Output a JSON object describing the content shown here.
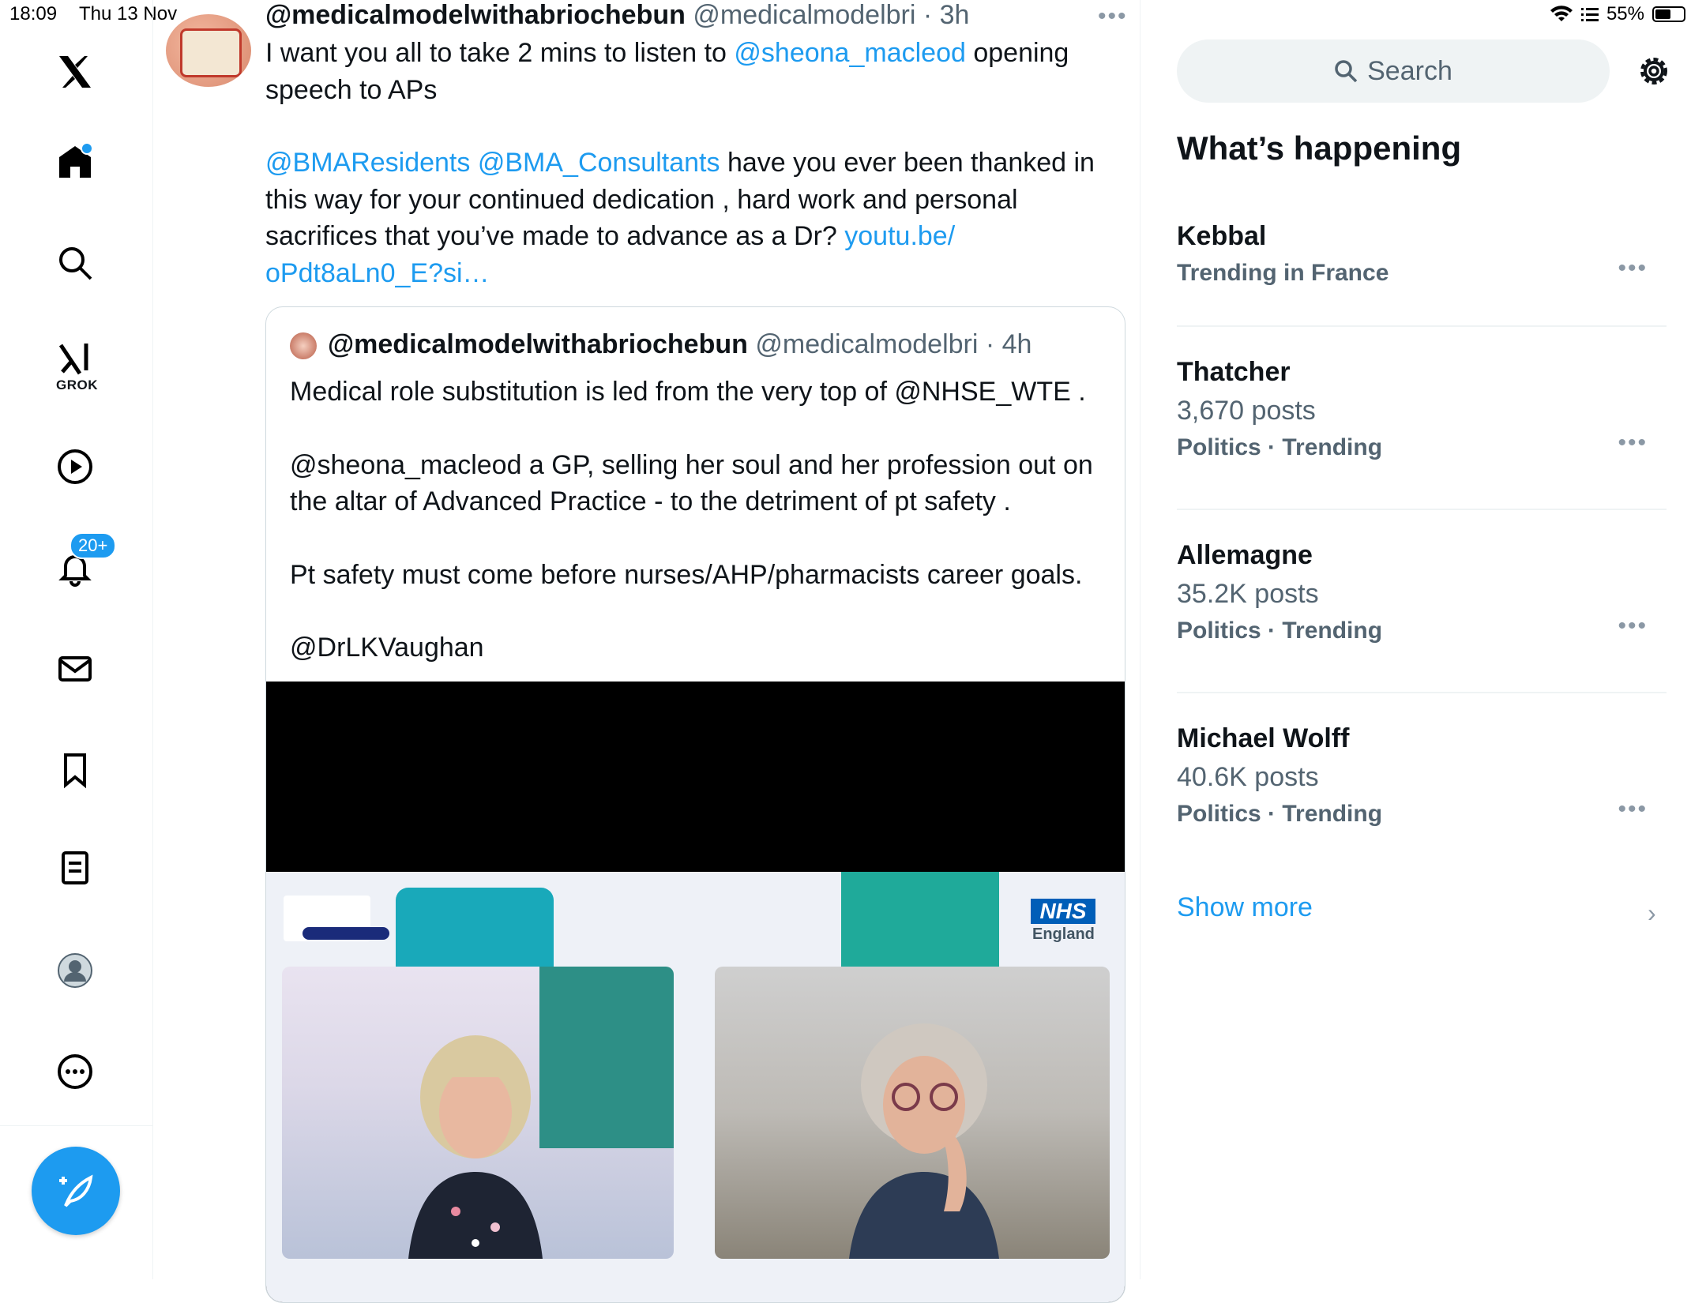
{
  "status_bar": {
    "time": "18:09",
    "date": "Thu 13 Nov",
    "battery": "55%",
    "battery_level": 0.55
  },
  "nav": {
    "notifications_badge": "20+",
    "grok_label": "GROK",
    "items": [
      "x-logo",
      "home",
      "search",
      "grok",
      "videos",
      "notifications",
      "messages",
      "bookmarks",
      "lists",
      "profile",
      "more"
    ]
  },
  "tweet": {
    "display_name": "@medicalmodelwithabriochebun",
    "handle": "@medicalmodelbri",
    "time": "3h",
    "line1_pre": "I want you all to take 2 mins to listen to ",
    "mention1": "@sheona_macleod",
    "line1_post": " opening speech to APs",
    "mention2": "@BMAResidents",
    "mention3": "@BMA_Consultants",
    "para2": " have you ever been thanked in this way for your continued dedication , hard work and personal sacrifices that you’ve made to advance as a Dr? ",
    "link": "youtu.be/ oPdt8aLn0_E?si…"
  },
  "quote": {
    "display_name": "@medicalmodelwithabriochebun",
    "handle": "@medicalmodelbri",
    "time": "4h",
    "para1": "Medical role substitution is led from the very top of @NHSE_WTE .",
    "para2": "@sheona_macleod a GP, selling her soul and her profession out on the altar of Advanced Practice - to the detriment of pt safety .",
    "para3": "Pt safety must come before nurses/AHP/pharmacists career goals.",
    "para4": "@DrLKVaughan",
    "media": {
      "nhs_logo": "NHS",
      "nhs_sub": "England"
    }
  },
  "sidebar": {
    "search_placeholder": "Search",
    "title": "What’s happening",
    "trends": [
      {
        "name": "Kebbal",
        "count": "",
        "category": "Trending in France"
      },
      {
        "name": "Thatcher",
        "count": "3,670 posts",
        "category": "Politics · Trending"
      },
      {
        "name": "Allemagne",
        "count": "35.2K posts",
        "category": "Politics · Trending"
      },
      {
        "name": "Michael Wolff",
        "count": "40.6K posts",
        "category": "Politics · Trending"
      }
    ],
    "show_more": "Show more"
  },
  "colors": {
    "accent": "#1d9bf0",
    "text": "#0f1419",
    "muted": "#536471"
  }
}
